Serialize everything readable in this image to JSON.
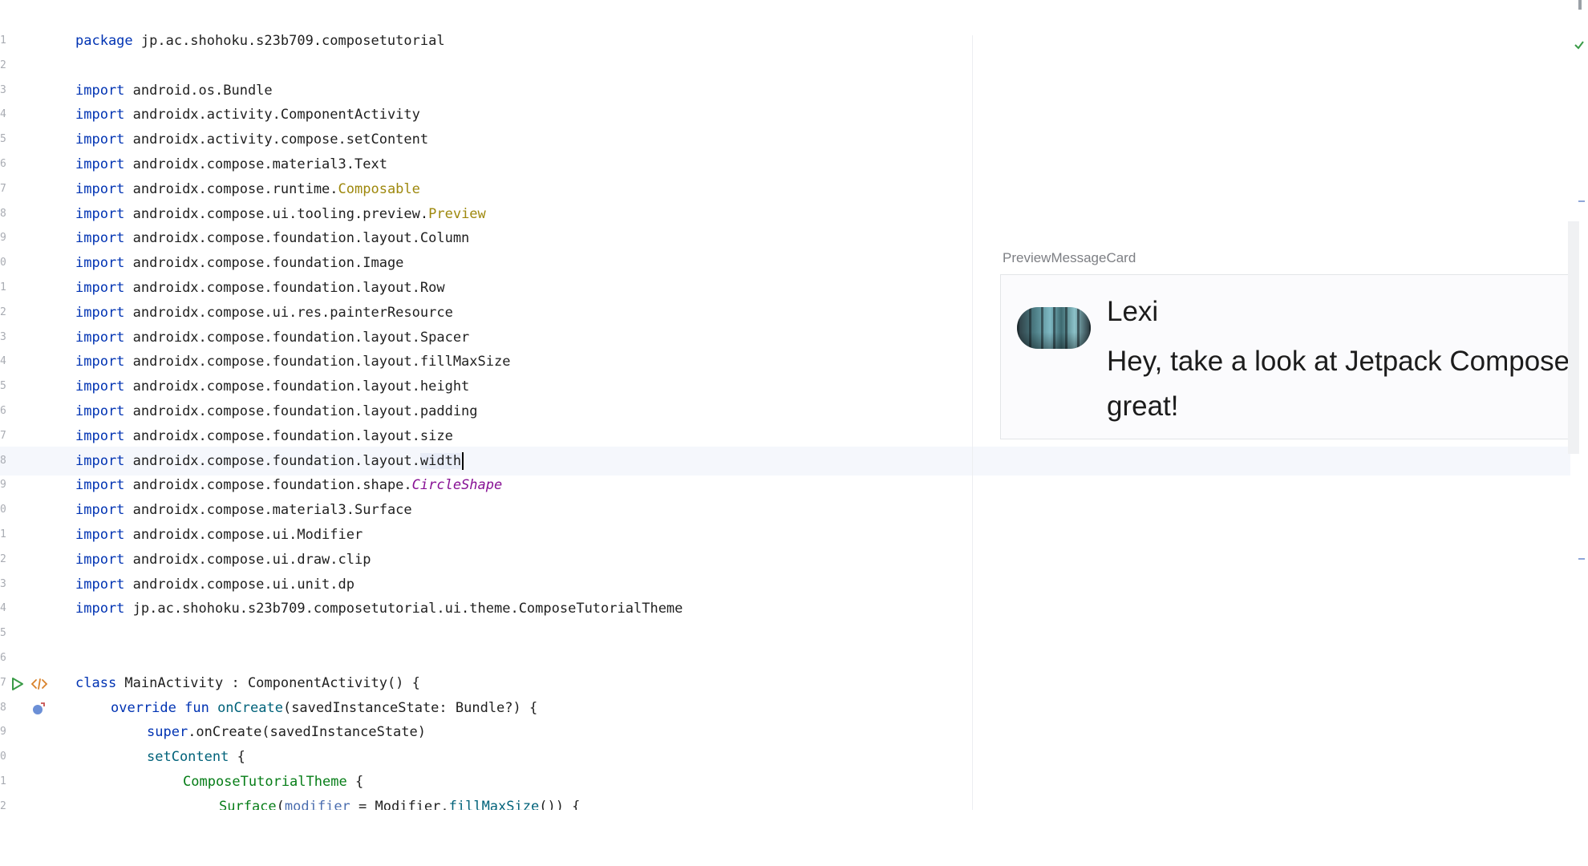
{
  "editor": {
    "lines": [
      {
        "num": "1",
        "text": ""
      },
      {
        "num": "2",
        "text": ""
      },
      {
        "num": "3",
        "text": ""
      },
      {
        "num": "4",
        "text": ""
      },
      {
        "num": "5",
        "text": ""
      },
      {
        "num": "6",
        "text": ""
      },
      {
        "num": "7",
        "text": ""
      },
      {
        "num": "8",
        "text": ""
      },
      {
        "num": "9",
        "text": ""
      },
      {
        "num": "0",
        "text": ""
      },
      {
        "num": "1",
        "text": ""
      },
      {
        "num": "2",
        "text": ""
      },
      {
        "num": "3",
        "text": ""
      },
      {
        "num": "4",
        "text": ""
      },
      {
        "num": "5",
        "text": ""
      },
      {
        "num": "6",
        "text": ""
      },
      {
        "num": "7",
        "text": ""
      },
      {
        "num": "8",
        "text": ""
      },
      {
        "num": "9",
        "text": ""
      },
      {
        "num": "0",
        "text": ""
      },
      {
        "num": "1",
        "text": ""
      },
      {
        "num": "2",
        "text": ""
      },
      {
        "num": "3",
        "text": ""
      },
      {
        "num": "4",
        "text": ""
      },
      {
        "num": "5",
        "text": ""
      },
      {
        "num": "6",
        "text": ""
      },
      {
        "num": "7",
        "text": ""
      },
      {
        "num": "8",
        "text": ""
      },
      {
        "num": "9",
        "text": ""
      },
      {
        "num": "0",
        "text": ""
      },
      {
        "num": "1",
        "text": ""
      },
      {
        "num": "2",
        "text": ""
      }
    ],
    "code": {
      "l1_kw": "package",
      "l1_rest": " jp.ac.shohoku.s23b709.composetutorial",
      "import_kw": "import",
      "l3": " android.os.Bundle",
      "l4": " androidx.activity.ComponentActivity",
      "l5": " androidx.activity.compose.setContent",
      "l6": " androidx.compose.material3.Text",
      "l7_pre": " androidx.compose.runtime.",
      "l7_ann": "Composable",
      "l8_pre": " androidx.compose.ui.tooling.preview.",
      "l8_ann": "Preview",
      "l9": " androidx.compose.foundation.layout.Column",
      "l10": " androidx.compose.foundation.Image",
      "l11": " androidx.compose.foundation.layout.Row",
      "l12": " androidx.compose.ui.res.painterResource",
      "l13": " androidx.compose.foundation.layout.Spacer",
      "l14": " androidx.compose.foundation.layout.fillMaxSize",
      "l15": " androidx.compose.foundation.layout.height",
      "l16": " androidx.compose.foundation.layout.padding",
      "l17": " androidx.compose.foundation.layout.size",
      "l18_pre": " androidx.compose.foundation.layout.",
      "l18_hl": "width",
      "l19_pre": " androidx.compose.foundation.shape.",
      "l19_purple": "CircleShape",
      "l20": " androidx.compose.material3.Surface",
      "l21": " androidx.compose.ui.Modifier",
      "l22": " androidx.compose.ui.draw.clip",
      "l23": " androidx.compose.ui.unit.dp",
      "l24": " jp.ac.shohoku.s23b709.composetutorial.ui.theme.ComposeTutorialTheme",
      "l27_kw": "class",
      "l27_rest": " MainActivity : ComponentActivity() {",
      "l28_kw": "override fun",
      "l28_fn": " onCreate",
      "l28_rest": "(savedInstanceState: Bundle?) {",
      "l29_kw": "super",
      "l29_rest": ".onCreate(savedInstanceState)",
      "l30_fn": "setContent",
      "l30_rest": " {",
      "l31_green": "ComposeTutorialTheme",
      "l31_rest": " {",
      "l32_green": "Surface",
      "l32_p1": "(",
      "l32_param": "modifier",
      "l32_mid": " = Modifier.",
      "l32_fn": "fillMaxSize",
      "l32_end": "()) {"
    }
  },
  "preview": {
    "title": "PreviewMessageCard",
    "author": "Lexi",
    "message": "Hey, take a look at Jetpack Compose, it's great!"
  },
  "colors": {
    "keyword": "#0033b3",
    "annotation": "#9e880d",
    "function": "#00627a",
    "purple": "#871094",
    "green": "#067d17"
  }
}
